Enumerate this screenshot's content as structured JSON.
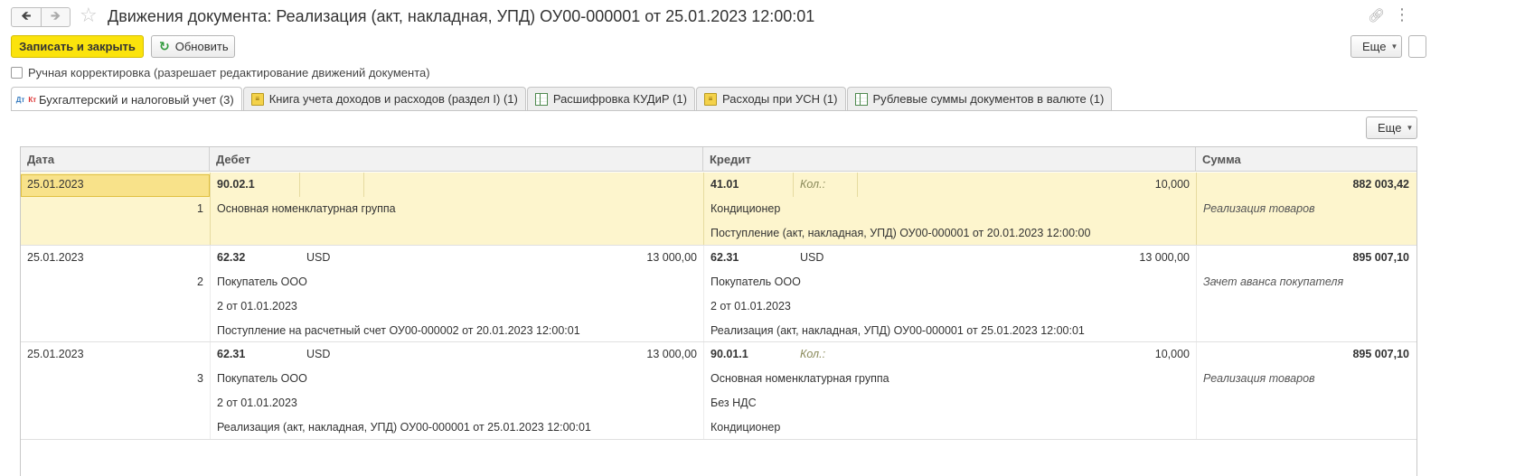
{
  "window": {
    "title": "Движения документа: Реализация (акт, накладная, УПД) ОУ00-000001 от 25.01.2023 12:00:01",
    "back_icon": "arrow-left-icon",
    "forward_icon": "arrow-right-icon",
    "favorite_icon": "star-icon",
    "link_icon": "link-icon",
    "menu_icon": "kebab-menu-icon"
  },
  "toolbar": {
    "save_close_label": "Записать и закрыть",
    "refresh_label": "Обновить",
    "more_label": "Еще"
  },
  "manual_edit": {
    "label": "Ручная корректировка (разрешает редактирование движений документа)",
    "checked": false
  },
  "tabs": [
    {
      "label": "Бухгалтерский и налоговый учет (3)",
      "icon": "dt-kt-icon",
      "active": true
    },
    {
      "label": "Книга учета доходов и расходов (раздел I) (1)",
      "icon": "book-icon",
      "active": false
    },
    {
      "label": "Расшифровка КУДиР (1)",
      "icon": "table-icon",
      "active": false
    },
    {
      "label": "Расходы при УСН (1)",
      "icon": "book-icon",
      "active": false
    },
    {
      "label": "Рублевые суммы документов в валюте (1)",
      "icon": "table-icon",
      "active": false
    }
  ],
  "table": {
    "more_label": "Еще",
    "columns": {
      "date": "Дата",
      "debit": "Дебет",
      "credit": "Кредит",
      "sum": "Сумма"
    },
    "kol_label": "Кол.:",
    "rows": [
      {
        "date": "25.01.2023",
        "num": "1",
        "debit_account": "90.02.1",
        "debit_currency": "",
        "debit_amount": "",
        "debit_lines": [
          "Основная номенклатурная группа",
          "",
          ""
        ],
        "credit_account": "41.01",
        "credit_currency": "",
        "credit_qty": "10,000",
        "credit_lines": [
          "Кондиционер",
          "Поступление (акт, накладная, УПД) ОУ00-000001 от 20.01.2023 12:00:00",
          ""
        ],
        "sum": "882 003,42",
        "content": "Реализация товаров"
      },
      {
        "date": "25.01.2023",
        "num": "2",
        "debit_account": "62.32",
        "debit_currency": "USD",
        "debit_amount": "13 000,00",
        "debit_lines": [
          "Покупатель ООО",
          "2 от 01.01.2023",
          "Поступление на расчетный счет ОУ00-000002 от 20.01.2023 12:00:01"
        ],
        "credit_account": "62.31",
        "credit_currency": "USD",
        "credit_amount": "13 000,00",
        "credit_lines": [
          "Покупатель ООО",
          "2 от 01.01.2023",
          "Реализация (акт, накладная, УПД) ОУ00-000001 от 25.01.2023 12:00:01"
        ],
        "sum": "895 007,10",
        "content": "Зачет аванса покупателя"
      },
      {
        "date": "25.01.2023",
        "num": "3",
        "debit_account": "62.31",
        "debit_currency": "USD",
        "debit_amount": "13 000,00",
        "debit_lines": [
          "Покупатель ООО",
          "2 от 01.01.2023",
          "Реализация (акт, накладная, УПД) ОУ00-000001 от 25.01.2023 12:00:01"
        ],
        "credit_account": "90.01.1",
        "credit_currency": "",
        "credit_qty": "10,000",
        "credit_lines": [
          "Основная номенклатурная группа",
          "Без НДС",
          "Кондиционер"
        ],
        "sum": "895 007,10",
        "content": "Реализация товаров"
      }
    ]
  }
}
